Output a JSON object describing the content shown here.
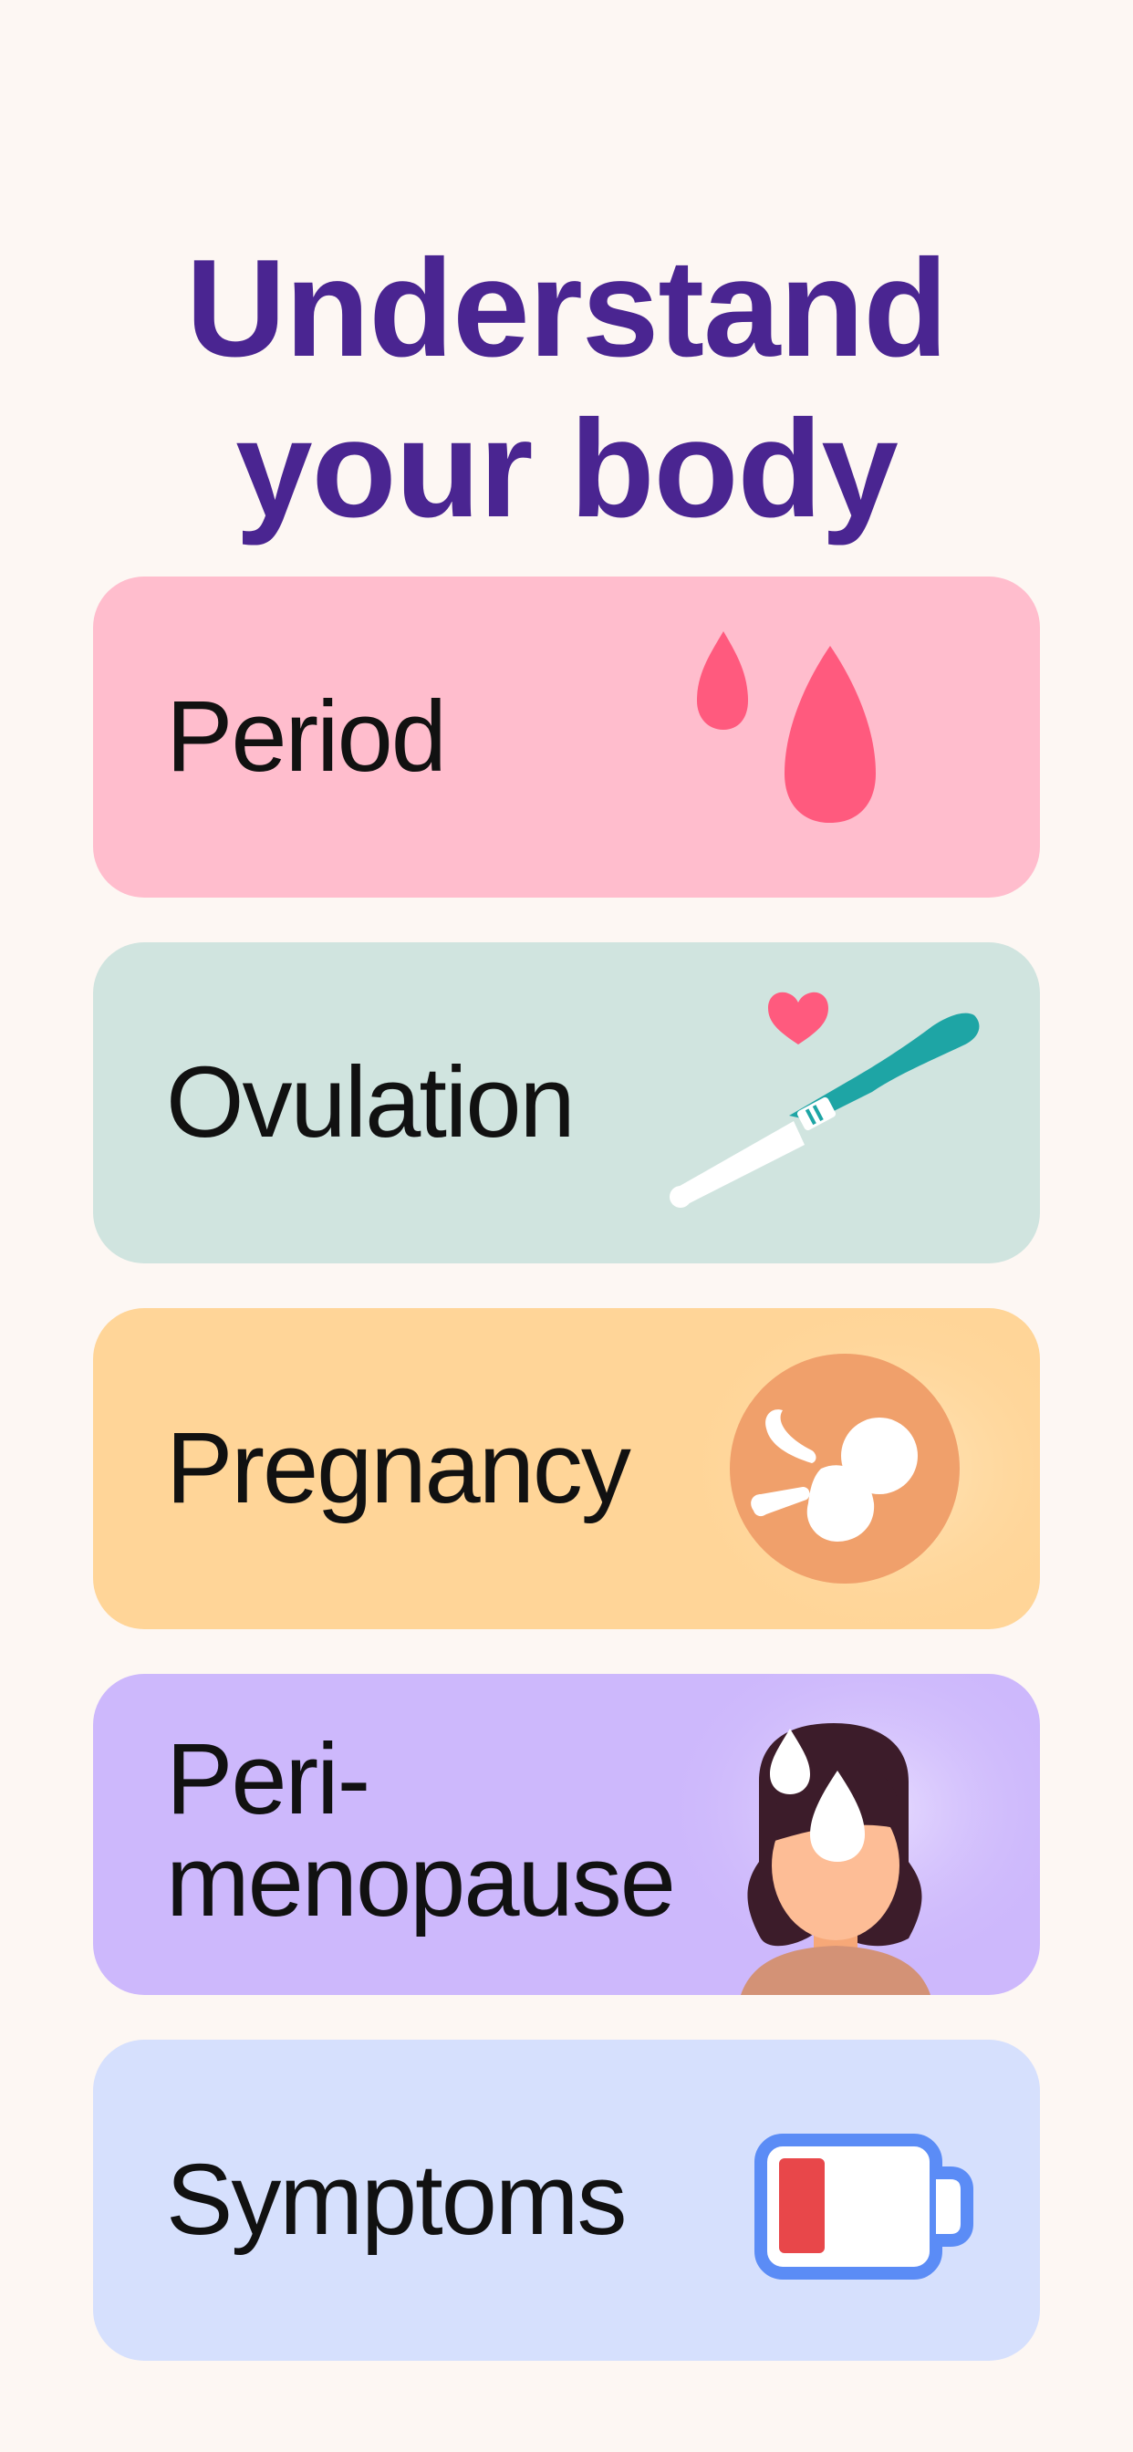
{
  "header": {
    "title_line1": "Understand",
    "title_line2": "your body"
  },
  "cards": [
    {
      "label": "Period",
      "icon": "blood-drops-icon",
      "color": "#ffbdcd"
    },
    {
      "label": "Ovulation",
      "icon": "ovulation-test-icon",
      "color": "#d0e4df"
    },
    {
      "label": "Pregnancy",
      "icon": "fetus-icon",
      "color": "#ffd598"
    },
    {
      "label_line1": "Peri-",
      "label_line2": "menopause",
      "icon": "woman-sweating-icon",
      "color": "#cdb8fc"
    },
    {
      "label": "Symptoms",
      "icon": "low-battery-icon",
      "color": "#d6e0fd"
    }
  ],
  "colors": {
    "background": "#fdf7f3",
    "title": "#4a2591",
    "accent_pink": "#ff5a7e",
    "accent_teal": "#1ea5a5",
    "accent_orange": "#f0a06b",
    "accent_blue": "#5b8cf6",
    "accent_red": "#e8474a"
  }
}
